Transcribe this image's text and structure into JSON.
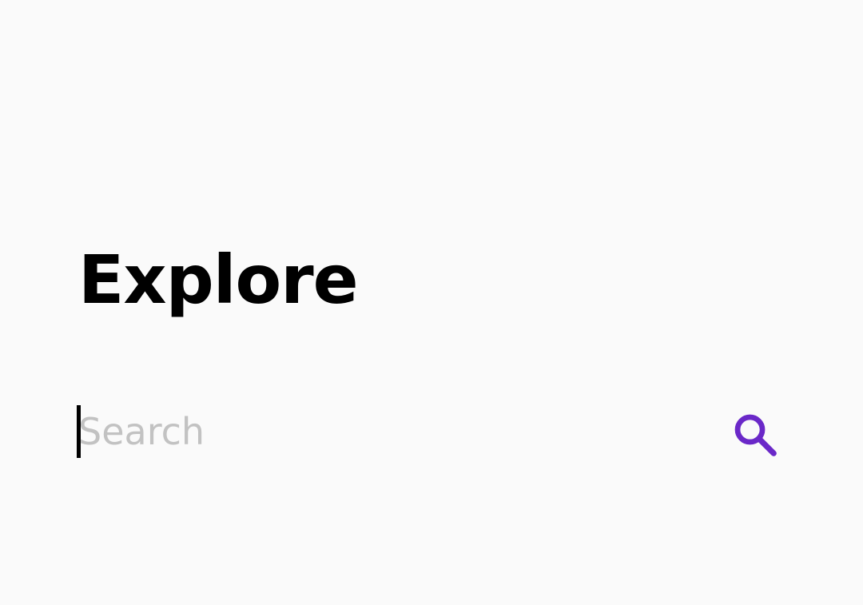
{
  "header": {
    "title": "Explore"
  },
  "search": {
    "value": "",
    "placeholder": "Search",
    "icon": "search-icon",
    "accent_color": "#6a28c8"
  },
  "colors": {
    "background": "#fafafa",
    "text": "#000000",
    "placeholder": "#c2c2c2"
  }
}
